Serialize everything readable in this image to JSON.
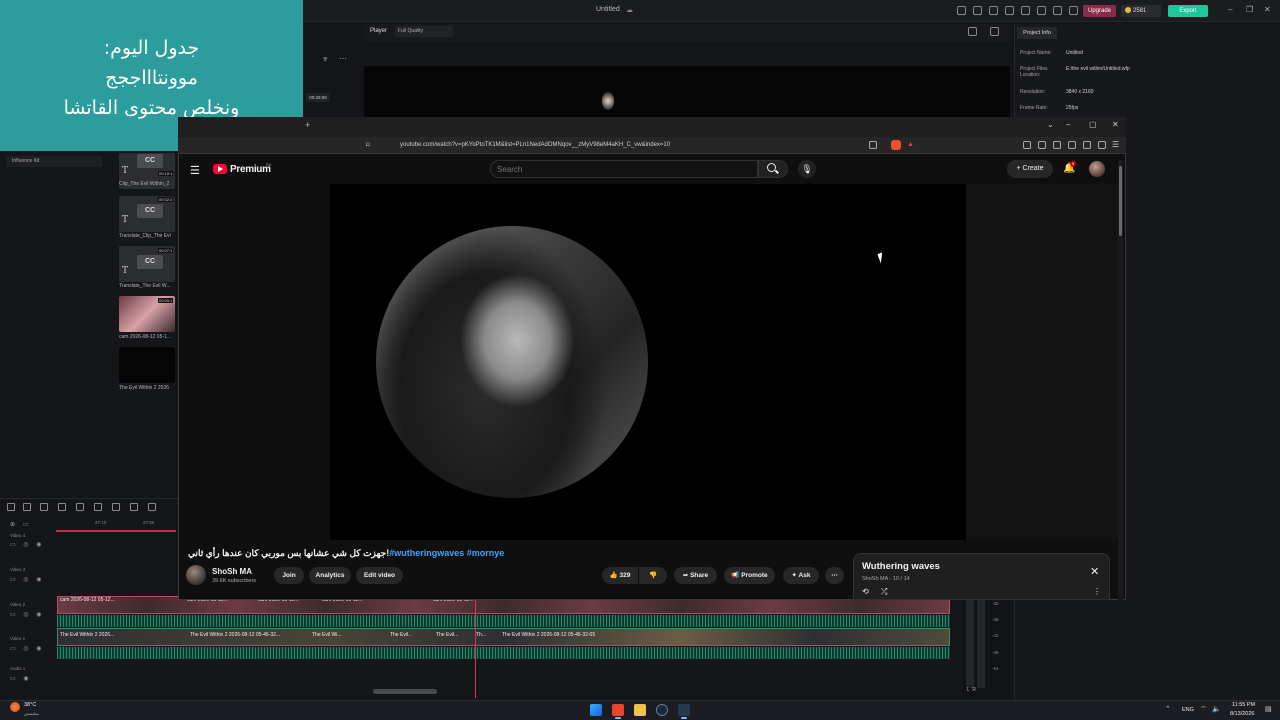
{
  "editor": {
    "title": "Untitled",
    "upgrade_label": "Upgrade",
    "credits": "2581",
    "export_label": "Export",
    "player_label": "Player",
    "quality": "Full Quality",
    "player_time": "00:26:59",
    "project_tab": "Project Info",
    "project_info": [
      {
        "label": "Project Name:",
        "value": "Untitled"
      },
      {
        "label": "Project Files Location:",
        "value": "E:/the evil within/Untitled.wfp"
      },
      {
        "label": "Resolution:",
        "value": "3840 x 2160"
      },
      {
        "label": "Frame Rate:",
        "value": "25fps"
      }
    ],
    "media_sidebar_item": "Influence Kit",
    "media": [
      {
        "name": "Clip_The Evil Within_2",
        "duration": "00:19:1"
      },
      {
        "name": "Translate_Clip_The Evi",
        "duration": "00:32:2"
      },
      {
        "name": "Translate_The Evil W...",
        "duration": "00:27:1"
      },
      {
        "name": "cam 2026-08-12 05-1...",
        "duration": "00:00:1"
      },
      {
        "name": "The Evil Within 2 2026",
        "duration": ""
      }
    ],
    "timeline": {
      "ticks": [
        "27:10",
        "27:55"
      ],
      "tracks": [
        "Video 4",
        "Video 3",
        "Video 2",
        "Video 1",
        "Audio 1"
      ],
      "clips_v2": [
        "cam 2026-08-12 05-12...",
        "cam 2026-08-12...",
        "cam 2026-08-12...",
        "cam 2026-08-12...",
        "cam 2026-08-12..."
      ],
      "clips_v1": [
        "The Evil Within 2 2026...",
        "The Evil Within 2 2026-08-12 05-46-32...",
        "The Evil Wi...",
        "The Evil...",
        "The Evil...",
        "Th...",
        "The Evil Within 2 2026-08-12 05-46-32-05"
      ],
      "meter_values": [
        "-30",
        "-36",
        "-42",
        "-48",
        "-54"
      ],
      "meter_lr": "L  R"
    }
  },
  "note": {
    "lines": [
      "جدول اليوم:",
      "موونتاااججج",
      "ونخلص محتوى القاتشا"
    ]
  },
  "browser": {
    "url": "youtube.com/watch?v=pKYoPtoTK1M&list=PLn1NedAdOMNqov__zMyV98eM4aKH_C_vw&index=10"
  },
  "youtube": {
    "logo_text": "Premium",
    "country": "SA",
    "search_placeholder": "Search",
    "create_label": "Create",
    "notif_count": "9",
    "video_title": "جهزت كل شي عشانها بس موربي كان عندها رأي ثاني!",
    "hashtags": "#wutheringwaves #mornye",
    "channel_name": "ShoSh MA",
    "subscribers": "39.6K subscribers",
    "buttons": {
      "join": "Join",
      "analytics": "Analytics",
      "edit_video": "Edit video",
      "likes": "329",
      "share": "Share",
      "promote": "Promote",
      "ask": "Ask"
    },
    "playlist": {
      "title": "Wuthering waves",
      "meta": "ShoSh MA - 10 / 14"
    }
  },
  "taskbar": {
    "temperature": "38°C",
    "weather": "مشمس",
    "lang": "ENG",
    "time": "11:55 PM",
    "date": "8/13/2026"
  }
}
